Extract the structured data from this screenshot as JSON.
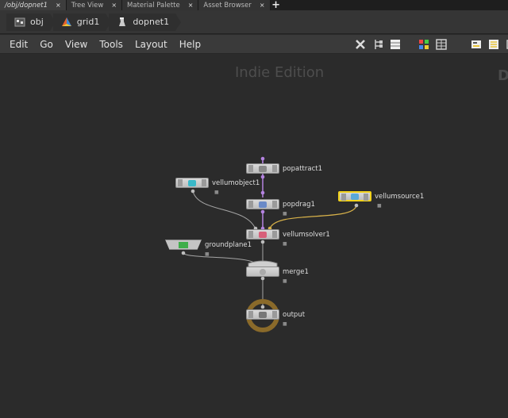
{
  "tabs": [
    {
      "label": "/obj/dopnet1",
      "active": true
    },
    {
      "label": "Tree View"
    },
    {
      "label": "Material Palette"
    },
    {
      "label": "Asset Browser"
    }
  ],
  "tab_close_glyph": "×",
  "tab_add_glyph": "+",
  "path": [
    {
      "label": "obj",
      "icon": "obj-network-icon"
    },
    {
      "label": "grid1",
      "icon": "geometry-icon"
    },
    {
      "label": "dopnet1",
      "icon": "dopnet-icon"
    }
  ],
  "menu": [
    "Edit",
    "Go",
    "View",
    "Tools",
    "Layout",
    "Help"
  ],
  "toolbar_icons": [
    "tools-icon",
    "tree-list-icon",
    "list-view-icon",
    "color-palette-icon",
    "grid-view-icon",
    "parameter-icon",
    "network-icon"
  ],
  "watermark": "Indie Edition",
  "watermark_partial": "D",
  "nodes": {
    "popattract": "popattract1",
    "vellumobject": "vellumobject1",
    "popdrag": "popdrag1",
    "vellumsource": "vellumsource1",
    "vellumsolver": "vellumsolver1",
    "groundplane": "groundplane1",
    "merge": "merge1",
    "output": "output"
  },
  "colors": {
    "background": "#2b2b2b",
    "selected_outline": "#f2d21b",
    "pop_wire": "#b483e0",
    "source_wire": "#d8b24a",
    "output_ring": "#8a6a2a"
  }
}
